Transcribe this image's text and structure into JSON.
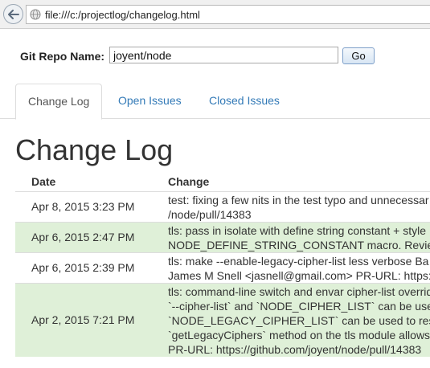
{
  "browser": {
    "url": "file:///c:/projectlog/changelog.html"
  },
  "form": {
    "label": "Git Repo Name:",
    "repo_value": "joyent/node",
    "go_label": "Go"
  },
  "tabs": [
    {
      "label": "Change Log",
      "active": true
    },
    {
      "label": "Open Issues",
      "active": false
    },
    {
      "label": "Closed Issues",
      "active": false
    }
  ],
  "main": {
    "title": "Change Log",
    "columns": {
      "date": "Date",
      "change": "Change"
    },
    "rows": [
      {
        "date": "Apr 8, 2015 3:23 PM",
        "lines": [
          "test: fixing a few nits in the test typo and unnecessar",
          "/node/pull/14383"
        ]
      },
      {
        "date": "Apr 6, 2015 2:47 PM",
        "lines": [
          "tls: pass in isolate with define string constant + style",
          "NODE_DEFINE_STRING_CONSTANT macro. Review"
        ]
      },
      {
        "date": "Apr 6, 2015 2:39 PM",
        "lines": [
          "tls: make --enable-legacy-cipher-list less verbose Ba",
          "James M Snell <jasnell@gmail.com> PR-URL: https:/"
        ]
      },
      {
        "date": "Apr 2, 2015 7:21 PM",
        "lines": [
          "tls: command-line switch and envar cipher-list overrid",
          "`--cipher-list` and `NODE_CIPHER_LIST` can be use",
          "`NODE_LEGACY_CIPHER_LIST` can be used to res",
          "`getLegacyCiphers` method on the tls module allows",
          "PR-URL: https://github.com/joyent/node/pull/14383"
        ]
      }
    ]
  },
  "colors": {
    "link": "#337ab7",
    "row_highlight": "#dff0d8"
  }
}
